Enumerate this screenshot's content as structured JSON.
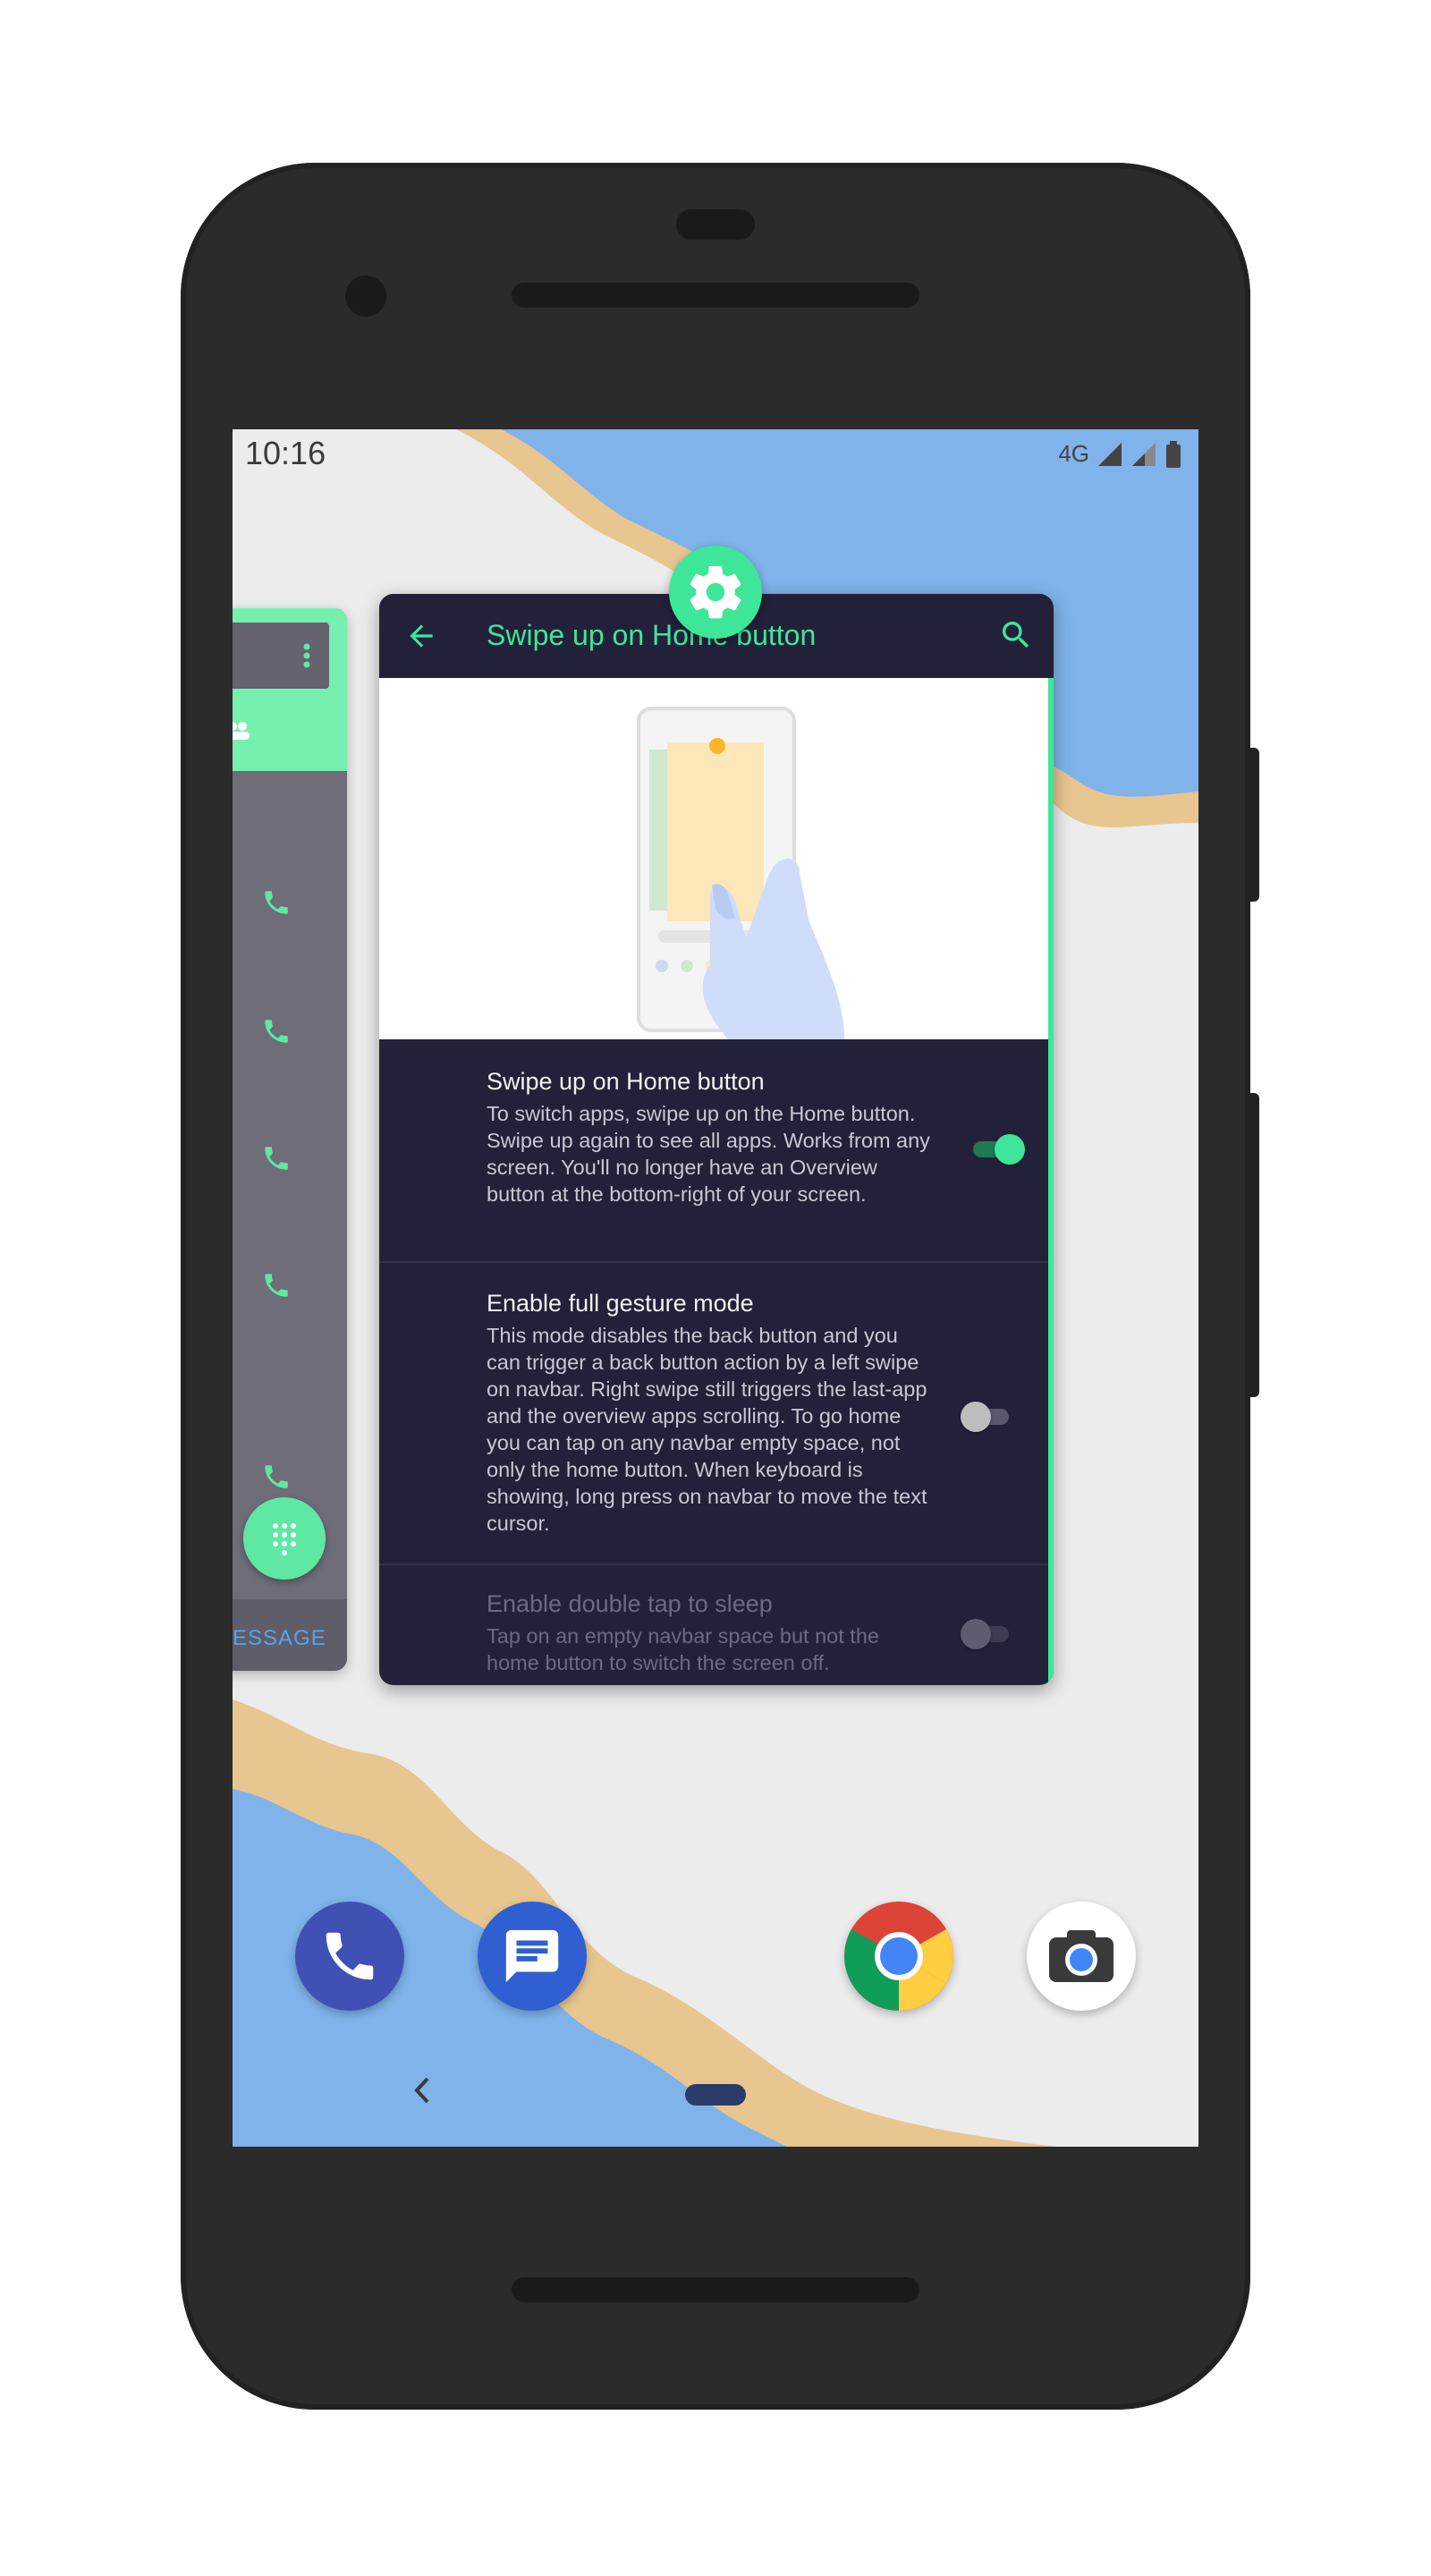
{
  "status_bar": {
    "time": "10:16",
    "network": "4G"
  },
  "left_card": {
    "bottom_label": "ESSAGE"
  },
  "settings_card": {
    "toolbar_title": "Swipe up on Home button",
    "preferences": [
      {
        "title": "Swipe up on Home button",
        "summary": "To switch apps, swipe up on the Home button. Swipe up again to see all apps. Works from any screen. You'll no longer have an Overview button at the bottom-right of your screen.",
        "enabled": true,
        "checked": true
      },
      {
        "title": "Enable full gesture mode",
        "summary": "This mode disables the back button and you can trigger a back button action by a left swipe on navbar. Right swipe still triggers the last-app and the overview apps scrolling. To go home you can tap on any navbar empty space, not only the home button. When keyboard is showing, long press on navbar to move the text cursor.",
        "enabled": true,
        "checked": false
      },
      {
        "title": "Enable double tap to sleep",
        "summary": "Tap on an empty navbar space but not the home button to switch the screen off.",
        "enabled": false,
        "checked": false
      }
    ]
  },
  "dock": [
    "phone-icon",
    "messages-icon",
    "chrome-icon",
    "camera-icon"
  ],
  "colors": {
    "accent": "#3ee69a",
    "card_bg": "#23213a",
    "phone_body": "#2b2b2b"
  }
}
